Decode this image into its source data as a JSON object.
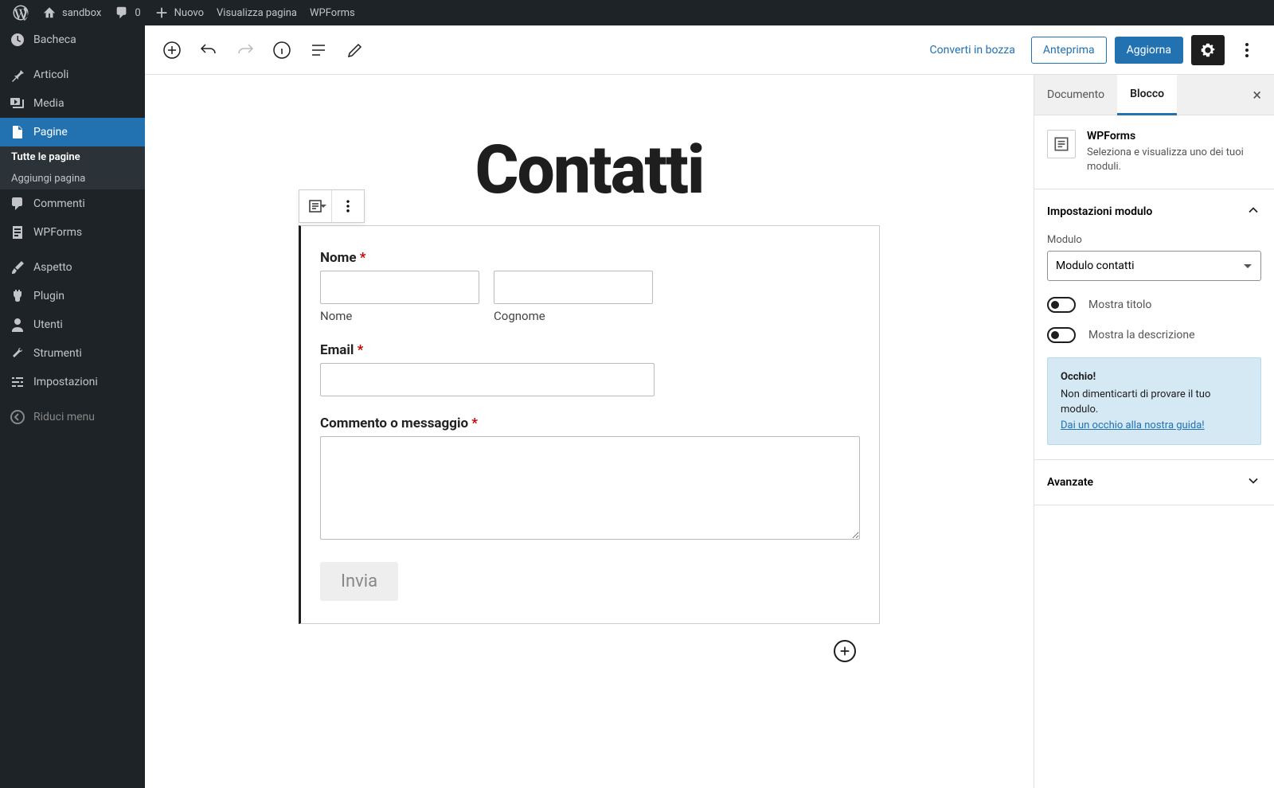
{
  "adminbar": {
    "site_name": "sandbox",
    "comments_count": "0",
    "new_label": "Nuovo",
    "view_page": "Visualizza pagina",
    "wpforms": "WPForms"
  },
  "sidebar": {
    "items": [
      {
        "label": "Bacheca"
      },
      {
        "label": "Articoli"
      },
      {
        "label": "Media"
      },
      {
        "label": "Pagine"
      },
      {
        "label": "Commenti"
      },
      {
        "label": "WPForms"
      },
      {
        "label": "Aspetto"
      },
      {
        "label": "Plugin"
      },
      {
        "label": "Utenti"
      },
      {
        "label": "Strumenti"
      },
      {
        "label": "Impostazioni"
      },
      {
        "label": "Riduci menu"
      }
    ],
    "submenu": {
      "all": "Tutte le pagine",
      "add": "Aggiungi pagina"
    }
  },
  "editor_header": {
    "draft_link": "Converti in bozza",
    "preview": "Anteprima",
    "update": "Aggiorna"
  },
  "canvas": {
    "page_title": "Contatti",
    "form": {
      "name_label": "Nome",
      "first_sub": "Nome",
      "last_sub": "Cognome",
      "email_label": "Email",
      "message_label": "Commento o messaggio",
      "submit": "Invia"
    }
  },
  "settings": {
    "tab_document": "Documento",
    "tab_block": "Blocco",
    "block_title": "WPForms",
    "block_desc": "Seleziona e visualizza uno dei tuoi moduli.",
    "panel_form_title": "Impostazioni modulo",
    "module_label": "Modulo",
    "module_value": "Modulo contatti",
    "show_title": "Mostra titolo",
    "show_desc": "Mostra la descrizione",
    "notice_title": "Occhio!",
    "notice_text": "Non dimenticarti di provare il tuo modulo.",
    "notice_link": "Dai un occhio alla nostra guida!",
    "panel_advanced": "Avanzate"
  }
}
